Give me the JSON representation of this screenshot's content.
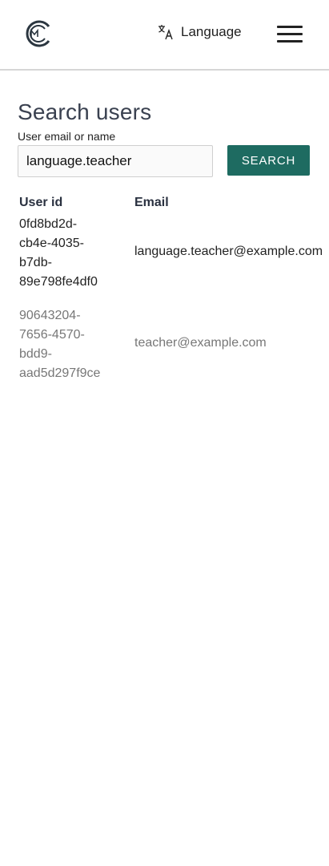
{
  "header": {
    "logo_name": "app-logo",
    "language_label": "Language",
    "language_icon": "translate-icon",
    "menu_icon": "hamburger-menu-icon"
  },
  "main": {
    "title": "Search users",
    "search": {
      "label": "User email or name",
      "value": "language.teacher",
      "placeholder": "",
      "button_label": "SEARCH"
    },
    "table": {
      "columns": [
        "User id",
        "Email"
      ],
      "rows": [
        {
          "id_lines": [
            "0fd8bd2d-",
            "cb4e-4035-",
            "b7db-",
            "89e798fe4df0"
          ],
          "email": "language.teacher@example.com"
        },
        {
          "id_lines": [
            "90643204-",
            "7656-4570-",
            "bdd9-",
            "aad5d297f9ce"
          ],
          "email": "teacher@example.com"
        }
      ]
    }
  },
  "colors": {
    "accent": "#1e6b61",
    "header_border": "#d6d6d6",
    "title": "#3a4150",
    "muted_text": "#777777"
  }
}
